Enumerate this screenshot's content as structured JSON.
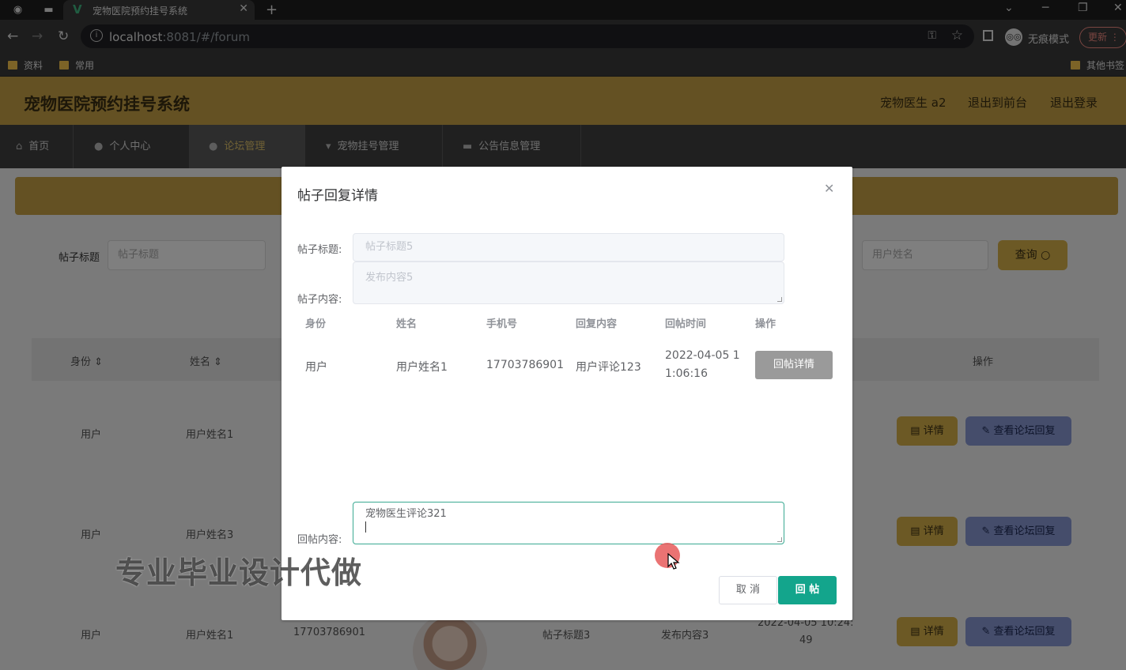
{
  "browser": {
    "tab_title": "宠物医院预约挂号系统",
    "url_host": "localhost",
    "url_rest": ":8081/#/forum",
    "incognito_label": "无痕模式",
    "update_label": "更新",
    "bookmarks": [
      "资料",
      "常用"
    ],
    "other_bookmarks": "其他书签"
  },
  "app": {
    "title": "宠物医院预约挂号系统",
    "header_links": [
      "宠物医生 a2",
      "退出到前台",
      "退出登录"
    ],
    "nav": [
      "首页",
      "个人中心",
      "论坛管理",
      "宠物挂号管理",
      "公告信息管理"
    ],
    "active_nav": "论坛管理"
  },
  "search": {
    "label": "帖子标题",
    "placeholder": "帖子标题",
    "user_placeholder": "用户姓名",
    "query_label": "查询"
  },
  "table": {
    "headers": [
      "身份",
      "姓名",
      "操作"
    ],
    "rows": [
      {
        "role": "用户",
        "name": "用户姓名1"
      },
      {
        "role": "用户",
        "name": "用户姓名3"
      },
      {
        "role": "用户",
        "name": "用户姓名1",
        "phone": "17703786901",
        "title": "帖子标题3",
        "content": "发布内容3",
        "time": "2022-04-05 10:24:",
        "time2": "49"
      }
    ],
    "detail_label": "详情",
    "view_label": "查看论坛回复"
  },
  "dialog": {
    "title": "帖子回复详情",
    "post_title_label": "帖子标题:",
    "post_title_value": "帖子标题5",
    "post_content_label": "帖子内容:",
    "post_content_value": "发布内容5",
    "columns": [
      "身份",
      "姓名",
      "手机号",
      "回复内容",
      "回帖时间",
      "操作"
    ],
    "reply_row": {
      "role": "用户",
      "name": "用户姓名1",
      "phone": "17703786901",
      "content": "用户评论123",
      "time_line1": "2022-04-05 1",
      "time_line2": "1:06:16",
      "action": "回帖详情"
    },
    "reply_label": "回帖内容:",
    "reply_value": "宠物医生评论321",
    "cancel_label": "取 消",
    "submit_label": "回 帖"
  },
  "overlay_watermark": "专业毕业设计代做",
  "colors": {
    "header": "#c9a347",
    "accent": "#13a58c",
    "nav": "#404040"
  }
}
